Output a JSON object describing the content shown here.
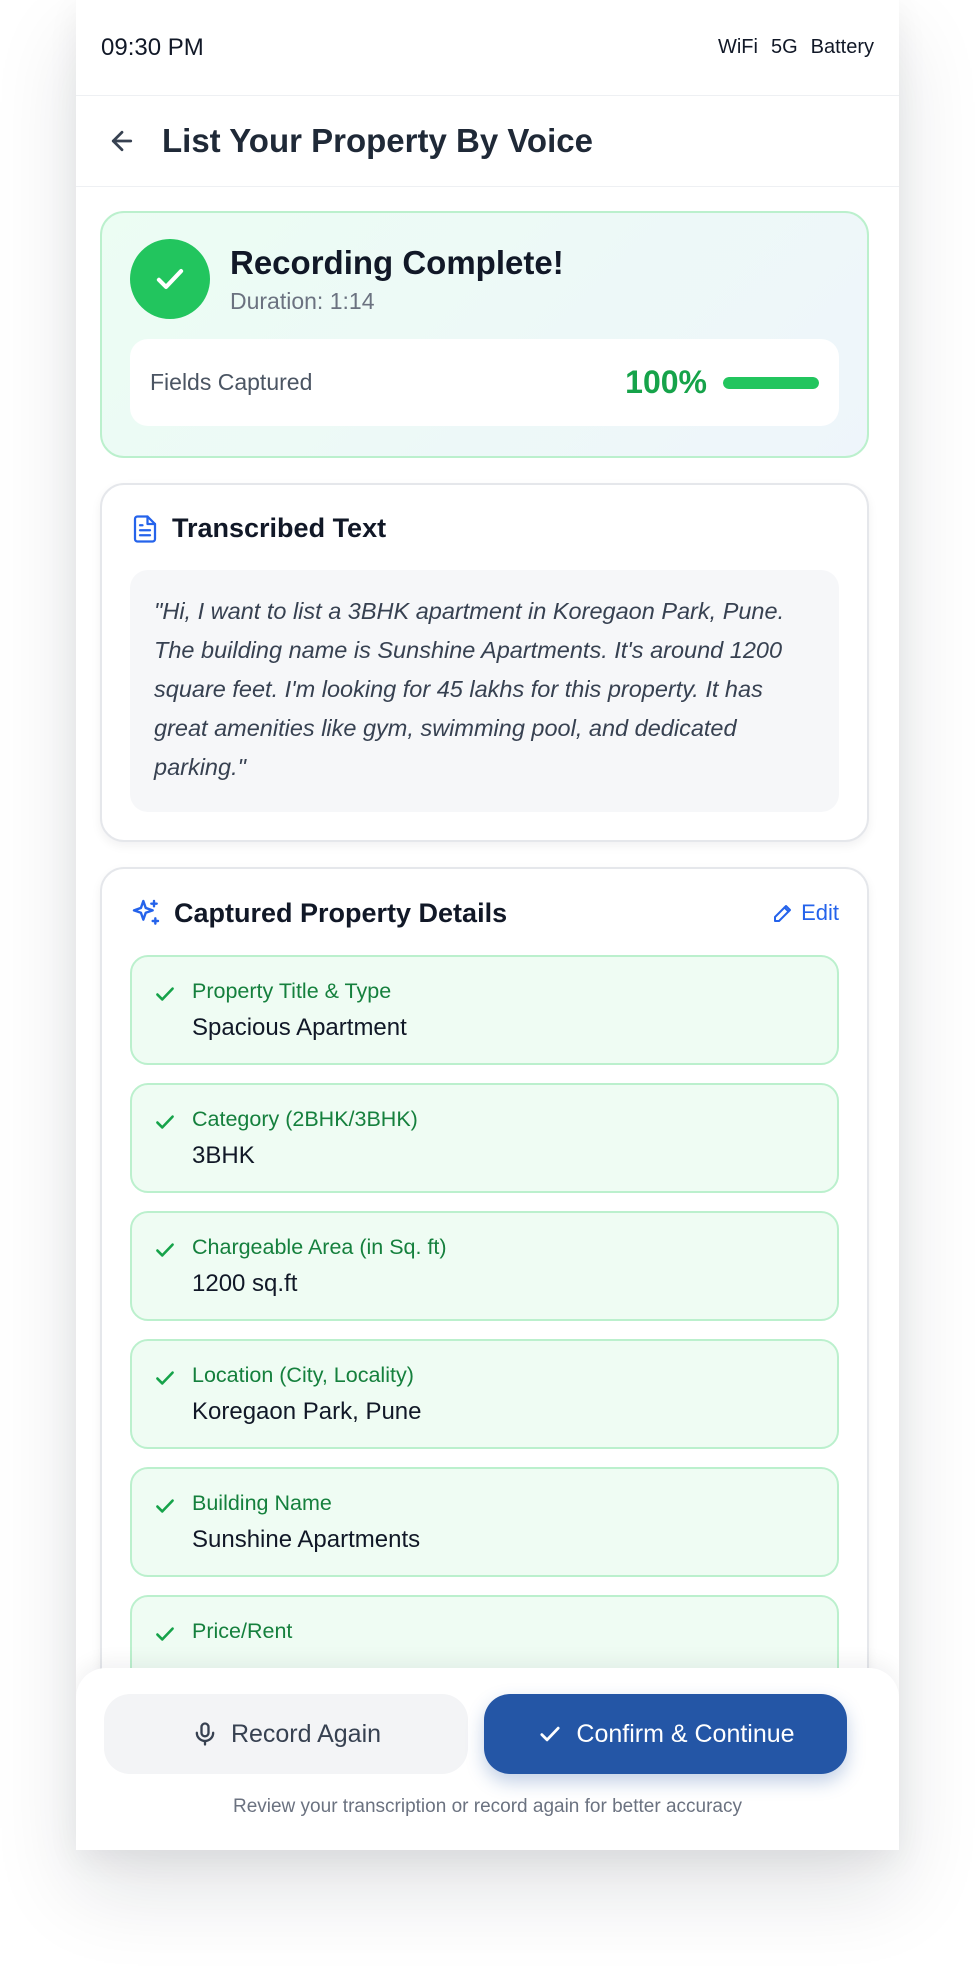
{
  "status_bar": {
    "time": "09:30 PM",
    "wifi": "WiFi",
    "network": "5G",
    "battery": "Battery"
  },
  "header": {
    "title": "List Your Property By Voice",
    "back_icon": "arrow-left-icon"
  },
  "recording": {
    "title": "Recording Complete!",
    "duration": "Duration: 1:14",
    "fields_label": "Fields Captured",
    "percent_text": "100%",
    "progress": 1.0,
    "accent": "#22c55e"
  },
  "transcript": {
    "title": "Transcribed Text",
    "text": "\"Hi, I want to list a 3BHK apartment in Koregaon Park, Pune. The building name is Sunshine Apartments. It's around 1200 square feet. I'm looking for 45 lakhs for this property. It has great amenities like gym, swimming pool, and dedicated parking.\""
  },
  "details": {
    "title": "Captured Property Details",
    "edit_label": "Edit",
    "fields": [
      {
        "label": "Property Title & Type",
        "value": "Spacious Apartment"
      },
      {
        "label": "Category (2BHK/3BHK)",
        "value": "3BHK"
      },
      {
        "label": "Chargeable Area (in Sq. ft)",
        "value": "1200 sq.ft"
      },
      {
        "label": "Location (City, Locality)",
        "value": "Koregaon Park, Pune"
      },
      {
        "label": "Building Name",
        "value": "Sunshine Apartments"
      },
      {
        "label": "Price/Rent",
        "value": ""
      }
    ]
  },
  "actions": {
    "record_again": "Record Again",
    "confirm": "Confirm & Continue",
    "hint": "Review your transcription or record again for better accuracy",
    "primary_color": "#2456a6"
  }
}
